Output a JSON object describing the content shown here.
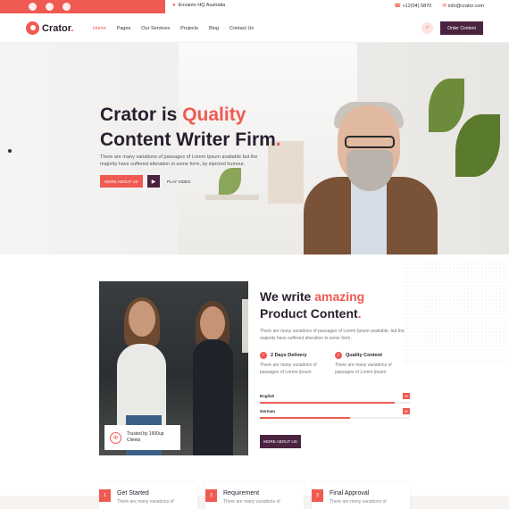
{
  "topbar": {
    "social_icons": [
      "facebook-icon",
      "twitter-icon",
      "instagram-icon"
    ],
    "address": "Envanto HQ Australia",
    "phone": "+12(04) 5870",
    "email": "info@crator.com"
  },
  "header": {
    "logo_text": "Crator",
    "nav": [
      "Home",
      "Pages",
      "Our Services",
      "Projects",
      "Blog",
      "Contact Us"
    ],
    "active_nav": "Home",
    "order_button": "Order Content"
  },
  "hero": {
    "title_line1_prefix": "Crator is",
    "title_line1_highlight": "Quality",
    "title_line2": "Content Writer Firm",
    "description": "There are many variations of passages of Lorem Ipsum available but the majority have suffered alteration in some form, by injected humour.",
    "more_button": "MORE ABOUT US",
    "play_label": "PLAY VIDEO"
  },
  "about": {
    "title_prefix": "We write",
    "title_highlight": "amazing",
    "title_line2": "Product Content",
    "description": "There are many variations of passages of Lorem Ipsum available, but the majority have suffered alteration in some form.",
    "features": [
      {
        "title": "2 Days Delivery",
        "desc": "There are many variations of passages of Lorem Ipsum"
      },
      {
        "title": "Quality Content",
        "desc": "There are many variations of passages of Lorem Ipsum"
      }
    ],
    "skills": [
      {
        "label": "English",
        "percent": 90,
        "tag": "90"
      },
      {
        "label": "German",
        "percent": 60,
        "tag": "60"
      }
    ],
    "button": "MORE ABOUT US",
    "trust_text": "Trusted by 1500up Clients"
  },
  "steps": [
    {
      "num": "1",
      "title": "Get Started",
      "desc": "There are many variations of"
    },
    {
      "num": "2",
      "title": "Requirement",
      "desc": "There are many variations of"
    },
    {
      "num": "3",
      "title": "Final Approval",
      "desc": "There are many variations of"
    }
  ],
  "colors": {
    "accent": "#ef5a52",
    "dark": "#4a2340"
  }
}
